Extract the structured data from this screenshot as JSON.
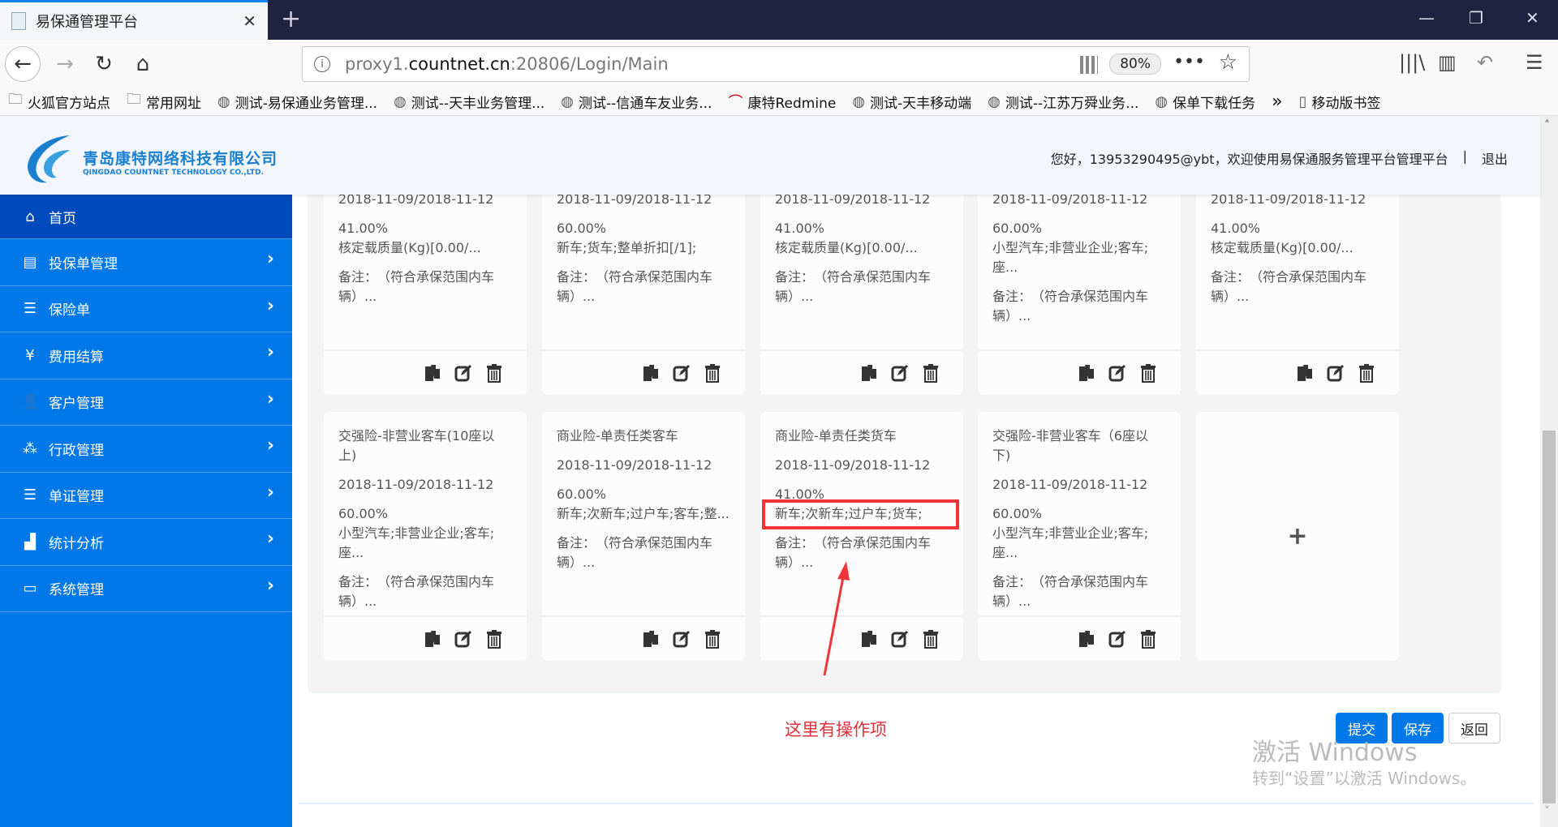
{
  "browser": {
    "tab_title": "易保通管理平台",
    "url_prefix": "proxy1.",
    "url_domain": "countnet.cn",
    "url_suffix": ":20806/Login/Main",
    "zoom": "80%",
    "bookmarks": [
      {
        "label": "火狐官方站点",
        "icon": "folder-icon"
      },
      {
        "label": "常用网址",
        "icon": "folder-icon"
      },
      {
        "label": "测试-易保通业务管理...",
        "icon": "globe-icon"
      },
      {
        "label": "测试--天丰业务管理...",
        "icon": "globe-icon"
      },
      {
        "label": "测试--信通车友业务...",
        "icon": "globe-icon"
      },
      {
        "label": "康特Redmine",
        "icon": "redmine-icon"
      },
      {
        "label": "测试-天丰移动端",
        "icon": "globe-icon"
      },
      {
        "label": "测试--江苏万舜业务...",
        "icon": "globe-icon"
      },
      {
        "label": "保单下载任务",
        "icon": "globe-icon"
      }
    ],
    "mobile_bookmarks": "移动版书签"
  },
  "header": {
    "company_cn": "青岛康特网络科技有限公司",
    "company_en": "QINGDAO COUNTNET TECHNOLOGY CO.,LTD.",
    "welcome": "您好，13953290495@ybt，欢迎使用易保通服务管理平台管理平台",
    "logout": "退出"
  },
  "sidebar": {
    "items": [
      {
        "label": "首页",
        "icon": "home-icon",
        "active": true
      },
      {
        "label": "投保单管理",
        "icon": "document-icon"
      },
      {
        "label": "保险单",
        "icon": "list-icon"
      },
      {
        "label": "费用结算",
        "icon": "money-bag-icon"
      },
      {
        "label": "客户管理",
        "icon": "users-icon"
      },
      {
        "label": "行政管理",
        "icon": "group-icon"
      },
      {
        "label": "单证管理",
        "icon": "list-icon"
      },
      {
        "label": "统计分析",
        "icon": "chart-icon"
      },
      {
        "label": "系统管理",
        "icon": "laptop-icon"
      }
    ]
  },
  "cards": [
    {
      "date": "2018-11-09/2018-11-12",
      "rate": "41.00%",
      "desc": "核定载质量(Kg)[0.00/...",
      "remark": "备注：　（符合承保范围内车辆）..."
    },
    {
      "date": "2018-11-09/2018-11-12",
      "rate": "60.00%",
      "desc": "新车;货车;整单折扣[/1];",
      "remark": "备注：　（符合承保范围内车辆）..."
    },
    {
      "date": "2018-11-09/2018-11-12",
      "rate": "41.00%",
      "desc": "核定载质量(Kg)[0.00/...",
      "remark": "备注：　（符合承保范围内车辆）..."
    },
    {
      "date": "2018-11-09/2018-11-12",
      "rate": "60.00%",
      "desc": "小型汽车;非营业企业;客车;座...",
      "remark": "备注：　（符合承保范围内车辆）..."
    },
    {
      "date": "2018-11-09/2018-11-12",
      "rate": "41.00%",
      "desc": "核定载质量(Kg)[0.00/...",
      "remark": "备注：　（符合承保范围内车辆）..."
    },
    {
      "title": "交强险-非营业客车(10座以上)",
      "date": "2018-11-09/2018-11-12",
      "rate": "60.00%",
      "desc": "小型汽车;非营业企业;客车;座...",
      "remark": "备注：　（符合承保范围内车辆）..."
    },
    {
      "title": "商业险-单责任类客车",
      "date": "2018-11-09/2018-11-12",
      "rate": "60.00%",
      "desc": "新车;次新车;过户车;客车;整...",
      "remark": "备注：　（符合承保范围内车辆）..."
    },
    {
      "title": "商业险-单责任类货车",
      "date": "2018-11-09/2018-11-12",
      "rate": "41.00%",
      "desc": "新车;次新车;过户车;货车;",
      "remark": "备注：　（符合承保范围内车辆）..."
    },
    {
      "title": "交强险-非营业客车（6座以下)",
      "date": "2018-11-09/2018-11-12",
      "rate": "60.00%",
      "desc": "小型汽车;非营业企业;客车;座...",
      "remark": "备注：　（符合承保范围内车辆）..."
    }
  ],
  "add_card": "+",
  "actions": {
    "submit": "提交",
    "save": "保存",
    "back": "返回"
  },
  "annotation": {
    "note": "这里有操作项",
    "color": "#f0343a"
  },
  "watermark": {
    "line1": "激活 Windows",
    "line2": "转到“设置”以激活 Windows。"
  },
  "colors": {
    "sidebar": "#0078e7",
    "sidebar_active": "#004bbb",
    "primary": "#0078e7",
    "header_bg": "#f3f7fd"
  }
}
